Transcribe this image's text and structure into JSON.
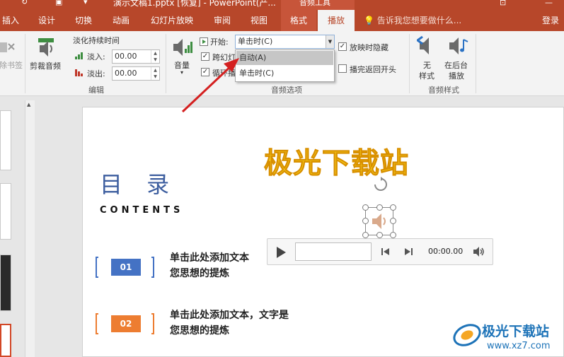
{
  "window": {
    "title": "演示文稿1.pptx [恢复] - PowerPoint(产...",
    "contextual_header": "音频工具",
    "login": "登录"
  },
  "tabs": [
    {
      "label": "插入"
    },
    {
      "label": "设计"
    },
    {
      "label": "切换"
    },
    {
      "label": "动画"
    },
    {
      "label": "幻灯片放映"
    },
    {
      "label": "审阅"
    },
    {
      "label": "视图"
    },
    {
      "label": "格式"
    },
    {
      "label": "播放"
    }
  ],
  "tell_me": "告诉我您想要做什么...",
  "ribbon": {
    "bookmark_label": "除书签",
    "trim_label": "剪裁音频",
    "fade_title": "淡化持续时间",
    "fade_in_label": "淡入:",
    "fade_in_value": "00.00",
    "fade_out_label": "淡出:",
    "fade_out_value": "00.00",
    "edit_group": "编辑",
    "volume_label": "音量",
    "start_label": "开始:",
    "start_value": "单击时(C)",
    "cross_slides_label": "跨幻灯片播放",
    "loop_label": "循环播放，直到停止",
    "hide_label": "放映时隐藏",
    "rewind_label": "播完返回开头",
    "audio_options_group": "音频选项",
    "no_style_label_1": "无",
    "no_style_label_2": "样式",
    "bg_play_label_1": "在后台",
    "bg_play_label_2": "播放",
    "audio_styles_group": "音频样式",
    "checks": {
      "cross_slides": true,
      "loop": true,
      "hide": true,
      "rewind": false
    }
  },
  "dropdown": {
    "options": [
      "自动(A)",
      "单击时(C)"
    ],
    "highlighted": "自动(A)"
  },
  "slide": {
    "wordart": "极光下载站",
    "heading": "目 录",
    "subheading": "CONTENTS",
    "items": [
      {
        "number": "01",
        "line1": "单击此处添加文本",
        "line2": "您思想的提炼",
        "color": "#4472c4"
      },
      {
        "number": "02",
        "line1": "单击此处添加文本，文字是",
        "line2": "您思想的提炼",
        "color": "#ed7d31"
      }
    ]
  },
  "player": {
    "time": "00:00.00"
  },
  "watermark": {
    "name": "极光下载站",
    "url": "www.xz7.com"
  },
  "colors": {
    "accent": "#b7472a",
    "wordart": "#f7d11a",
    "heading": "#3d5e9f"
  }
}
